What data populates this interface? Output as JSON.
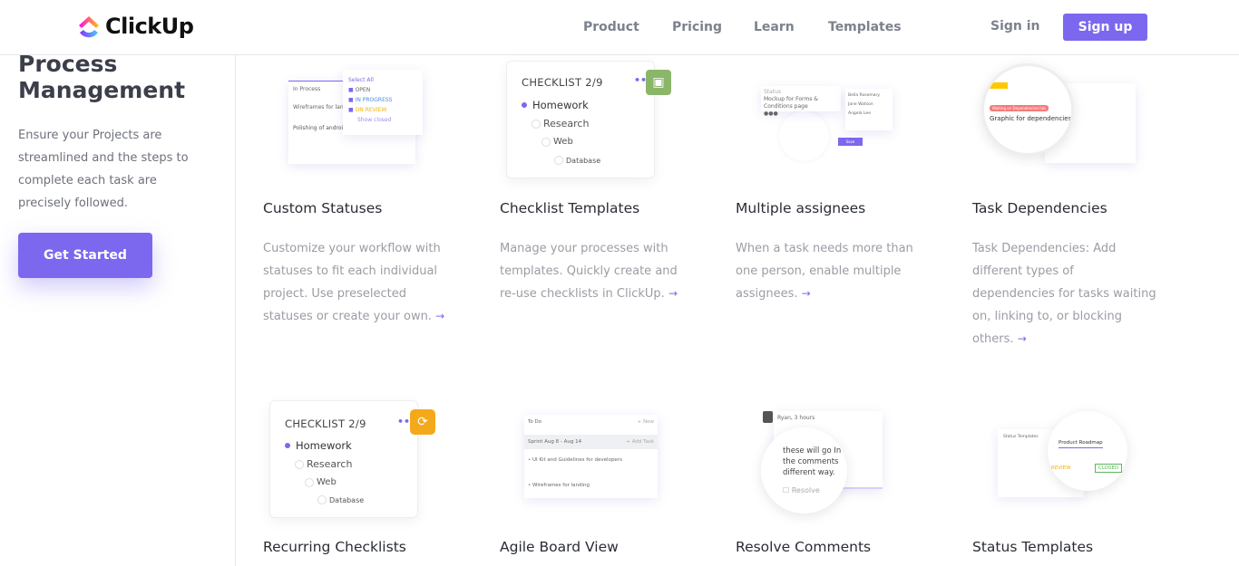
{
  "header": {
    "brand": "ClickUp",
    "nav": [
      "Product",
      "Pricing",
      "Learn",
      "Templates"
    ],
    "sign_in": "Sign in",
    "sign_up": "Sign up"
  },
  "colors": {
    "accent": "#7b68ee",
    "save_badge": "#8bb66a",
    "recurring_badge": "#f4a91a"
  },
  "left": {
    "title": "Process Management",
    "description": "Ensure your Projects are streamlined and the steps to complete each task are precisely followed.",
    "cta": "Get Started"
  },
  "features": [
    {
      "title": "Custom Statuses",
      "description": "Customize your workflow with statuses to fit each individual project. Use preselected statuses or create your own."
    },
    {
      "title": "Checklist Templates",
      "description": "Manage your processes with templates. Quickly create and re-use checklists in ClickUp."
    },
    {
      "title": "Multiple assignees",
      "description": "When a task needs more than one person, enable multiple assignees."
    },
    {
      "title": "Task Dependencies",
      "description": "Task Dependencies: Add different types of dependencies for tasks waiting on, linking to, or blocking others."
    },
    {
      "title": "Recurring Checklists"
    },
    {
      "title": "Agile Board View"
    },
    {
      "title": "Resolve Comments"
    },
    {
      "title": "Status Templates"
    }
  ],
  "illustrations": {
    "statuses": {
      "column": "In Process",
      "select_all": "Select All",
      "options": [
        "OPEN",
        "IN PROGRESS",
        "ON REVIEW"
      ],
      "show_closed": "Show closed",
      "task1": "Wireframes for land",
      "task2": "Polishing of android app"
    },
    "checklist": {
      "header": "CHECKLIST 2/9",
      "items": [
        "Homework",
        "Research",
        "Web",
        "Database"
      ]
    },
    "assignees": {
      "task": "Mockup for Forms & Conditions page",
      "people": [
        "Bella Rosemary",
        "Jane Watson",
        "Angela Lee"
      ],
      "button": "Save"
    },
    "dependencies": {
      "tag": "Waiting on Dependencies tab",
      "task": "Graphic for dependencies feature"
    },
    "agile": {
      "column": "To Do",
      "new": "+ New",
      "sprint": "Sprint Aug 8 - Aug 14",
      "add_task": "+ Add Task",
      "task1": "UI Kit and Guidelines for developers",
      "task2": "Wireframes for landing"
    },
    "comments": {
      "author": "Ryan, 3 hours",
      "text": "these will go In the comments different way.",
      "resolve": "Resolve"
    },
    "status_templates": {
      "title": "Status Templates",
      "tab": "Product Roadmap",
      "review": "REVIEW",
      "closed": "CLOSED"
    }
  }
}
